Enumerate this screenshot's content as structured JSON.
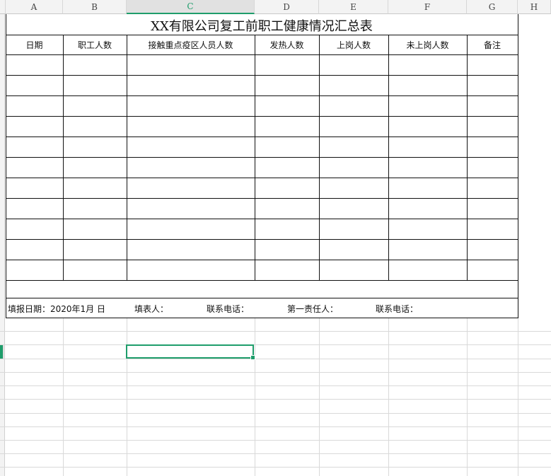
{
  "columns": [
    "A",
    "B",
    "C",
    "D",
    "E",
    "F",
    "G",
    "H"
  ],
  "active_column": "C",
  "title": "XX有限公司复工前职工健康情况汇总表",
  "headers": [
    "日期",
    "职工人数",
    "接触重点疫区人员人数",
    "发热人数",
    "上岗人数",
    "未上岗人数",
    "备注"
  ],
  "footer": {
    "fill_date": "填报日期：2020年1月   日",
    "filler": "填表人：",
    "contact_phone": "联系电话：",
    "first_responsible": "第一责任人：",
    "contact_phone2": "联系电话："
  },
  "colors": {
    "accent": "#1f9d6b",
    "grid": "#d9d9d9",
    "border": "#111111"
  }
}
